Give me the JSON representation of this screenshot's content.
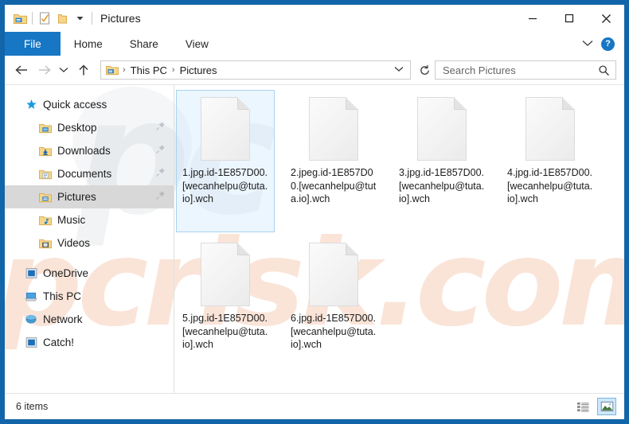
{
  "window": {
    "title": "Pictures",
    "quick_access_toolbar": [
      {
        "name": "folder-properties-icon",
        "label": "Pictures Properties"
      },
      {
        "name": "properties-check-icon",
        "label": "Properties"
      },
      {
        "name": "new-folder-icon",
        "label": "New folder"
      },
      {
        "name": "customize-chevron-icon",
        "label": "Customize Quick Access Toolbar"
      }
    ],
    "caption": {
      "minimize": "—",
      "maximize": "☐",
      "close": "✕"
    },
    "border_color": "#1265a8"
  },
  "ribbon": {
    "tabs": [
      {
        "label": "File",
        "active": true
      },
      {
        "label": "Home",
        "active": false
      },
      {
        "label": "Share",
        "active": false
      },
      {
        "label": "View",
        "active": false
      }
    ],
    "expand_label": "⌄",
    "help_label": "?",
    "file_tab_color": "#1777c4"
  },
  "address": {
    "back_label": "←",
    "forward_label": "→",
    "recent_label": "⌄",
    "up_label": "↑",
    "breadcrumb": [
      {
        "label": "This PC"
      },
      {
        "label": "Pictures"
      }
    ],
    "separator": "›",
    "dropdown_label": "⌄",
    "refresh_label": "↻"
  },
  "search": {
    "placeholder": "Search Pictures",
    "value": "",
    "icon": "search-icon"
  },
  "sidebar": {
    "items": [
      {
        "label": "Quick access",
        "icon": "pin-star-icon",
        "level": 0,
        "pinned": false,
        "selected": false
      },
      {
        "label": "Desktop",
        "icon": "desktop-folder-icon",
        "level": 1,
        "pinned": true,
        "selected": false
      },
      {
        "label": "Downloads",
        "icon": "downloads-folder-icon",
        "level": 1,
        "pinned": true,
        "selected": false
      },
      {
        "label": "Documents",
        "icon": "documents-folder-icon",
        "level": 1,
        "pinned": true,
        "selected": false
      },
      {
        "label": "Pictures",
        "icon": "pictures-folder-icon",
        "level": 1,
        "pinned": true,
        "selected": true
      },
      {
        "label": "Music",
        "icon": "music-folder-icon",
        "level": 1,
        "pinned": false,
        "selected": false
      },
      {
        "label": "Videos",
        "icon": "videos-folder-icon",
        "level": 1,
        "pinned": false,
        "selected": false
      },
      {
        "label": "OneDrive",
        "icon": "onedrive-icon",
        "level": 0,
        "pinned": false,
        "selected": false
      },
      {
        "label": "This PC",
        "icon": "this-pc-icon",
        "level": 0,
        "pinned": false,
        "selected": false
      },
      {
        "label": "Network",
        "icon": "network-icon",
        "level": 0,
        "pinned": false,
        "selected": false
      },
      {
        "label": "Catch!",
        "icon": "catch-icon",
        "level": 0,
        "pinned": false,
        "selected": false
      }
    ]
  },
  "files": [
    {
      "name": "1.jpg.id-1E857D00.[wecanhelpu@tuta.io].wch",
      "icon": "blank-document-icon",
      "selected": true
    },
    {
      "name": "2.jpeg.id-1E857D00.[wecanhelpu@tuta.io].wch",
      "icon": "blank-document-icon",
      "selected": false
    },
    {
      "name": "3.jpg.id-1E857D00.[wecanhelpu@tuta.io].wch",
      "icon": "blank-document-icon",
      "selected": false
    },
    {
      "name": "4.jpg.id-1E857D00.[wecanhelpu@tuta.io].wch",
      "icon": "blank-document-icon",
      "selected": false
    },
    {
      "name": "5.jpg.id-1E857D00.[wecanhelpu@tuta.io].wch",
      "icon": "blank-document-icon",
      "selected": false
    },
    {
      "name": "6.jpg.id-1E857D00.[wecanhelpu@tuta.io].wch",
      "icon": "blank-document-icon",
      "selected": false
    }
  ],
  "status": {
    "item_count_label": "6 items",
    "view_buttons": [
      {
        "name": "details-view-button",
        "active": false
      },
      {
        "name": "large-icons-view-button",
        "active": true
      }
    ]
  },
  "watermark": {
    "text": "pcrisk.com",
    "gray_text": "pc",
    "orange_color": "#e9864f",
    "gray_color": "#9ba0a8"
  }
}
